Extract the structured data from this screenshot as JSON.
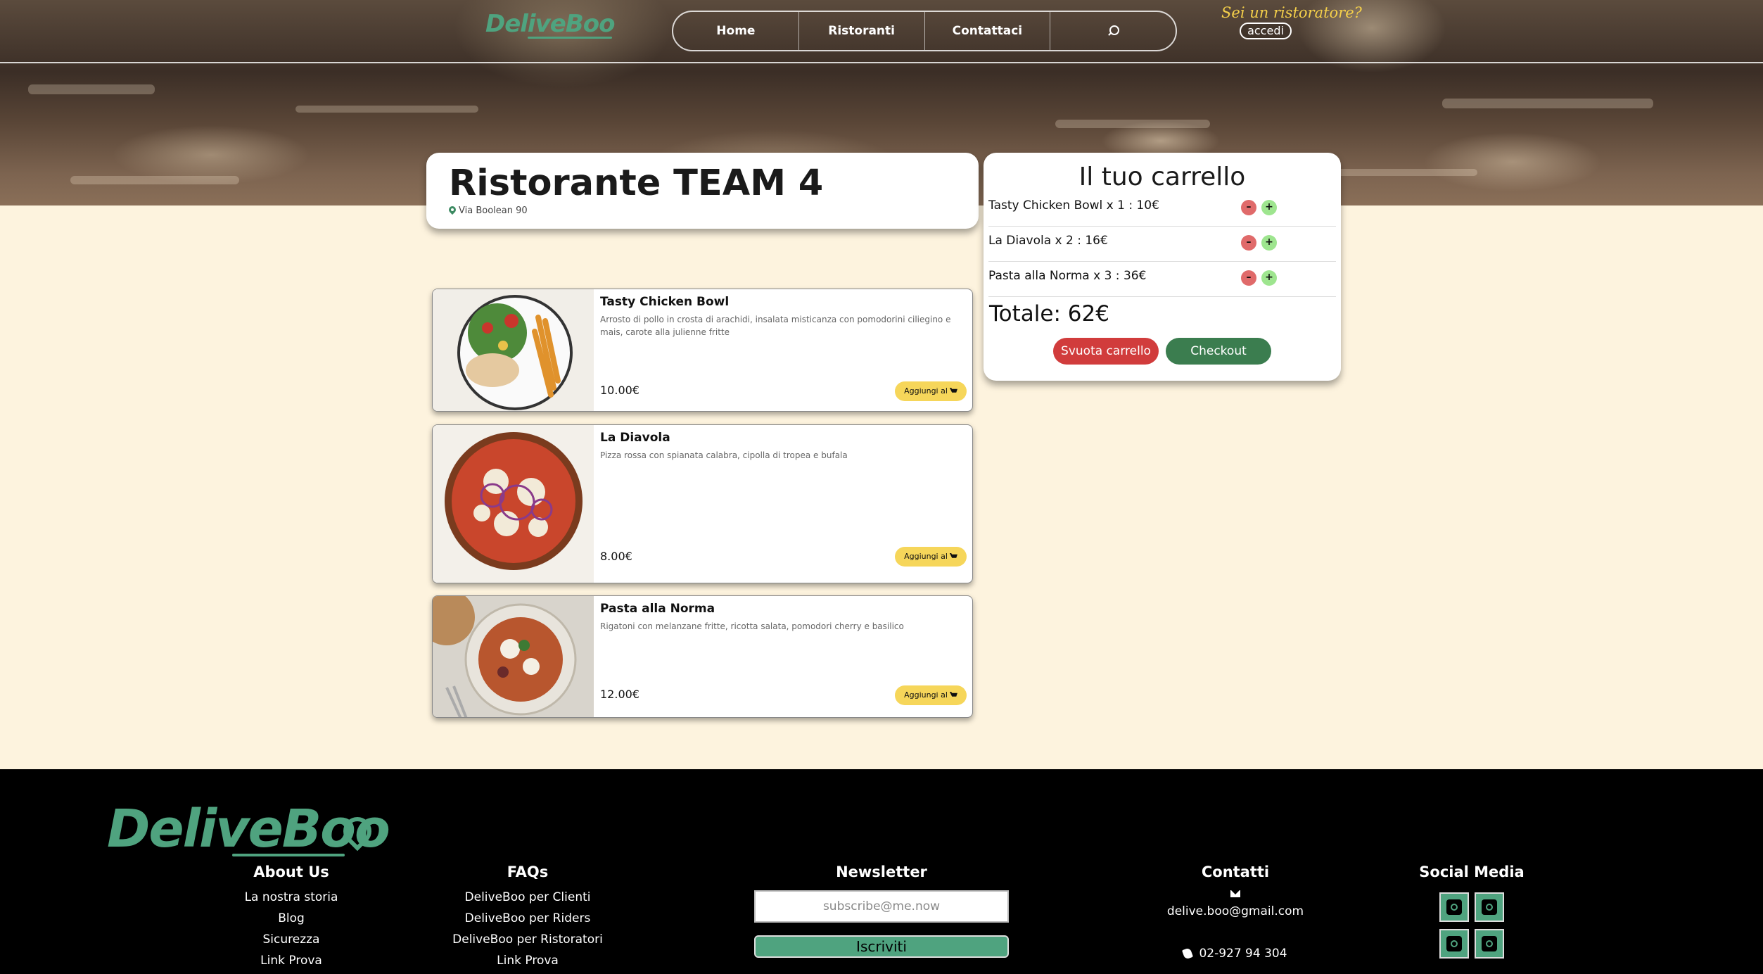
{
  "header": {
    "logo": "DeliveBoo",
    "nav": [
      "Home",
      "Ristoranti",
      "Contattaci"
    ],
    "owner_prompt": "Sei un ristoratore?",
    "login_label": "accedi"
  },
  "restaurant": {
    "name": "Ristorante TEAM 4",
    "address": "Via Boolean 90"
  },
  "cart": {
    "title": "Il tuo carrello",
    "items": [
      {
        "text": "Tasty Chicken Bowl x 1 : 10€"
      },
      {
        "text": "La Diavola x 2 : 16€"
      },
      {
        "text": "Pasta alla Norma x 3 : 36€"
      }
    ],
    "minus_label": "–",
    "plus_label": "+",
    "total": "Totale: 62€",
    "empty_label": "Svuota carrello",
    "checkout_label": "Checkout"
  },
  "dishes": [
    {
      "name": "Tasty Chicken Bowl",
      "description": "Arrosto di pollo in crosta di arachidi, insalata misticanza con pomodorini ciliegino e mais, carote alla julienne fritte",
      "price": "10.00€",
      "add_label": "Aggiungi al"
    },
    {
      "name": "La Diavola",
      "description": "Pizza rossa con spianata calabra, cipolla di tropea e bufala",
      "price": "8.00€",
      "add_label": "Aggiungi al"
    },
    {
      "name": "Pasta alla Norma",
      "description": "Rigatoni con melanzane fritte, ricotta salata, pomodori cherry e basilico",
      "price": "12.00€",
      "add_label": "Aggiungi al"
    }
  ],
  "footer": {
    "logo": "DeliveBoo",
    "about": {
      "title": "About Us",
      "links": [
        "La nostra storia",
        "Blog",
        "Sicurezza",
        "Link Prova"
      ]
    },
    "faqs": {
      "title": "FAQs",
      "links": [
        "DeliveBoo per Clienti",
        "DeliveBoo per Riders",
        "DeliveBoo per Ristoratori",
        "Link Prova"
      ]
    },
    "newsletter": {
      "title": "Newsletter",
      "placeholder": "subscribe@me.now",
      "button": "Iscriviti"
    },
    "contacts": {
      "title": "Contatti",
      "email": "delive.boo@gmail.com",
      "phone": "02-927 94 304"
    },
    "social": {
      "title": "Social Media",
      "icons": [
        "twitter-icon",
        "instagram-icon",
        "facebook-icon",
        "reddit-icon"
      ]
    }
  },
  "colors": {
    "accent": "#4fa37f",
    "background": "#fdf3de",
    "add_button": "#f6d65a",
    "danger": "#d13c3c",
    "success": "#3b7d4f"
  }
}
